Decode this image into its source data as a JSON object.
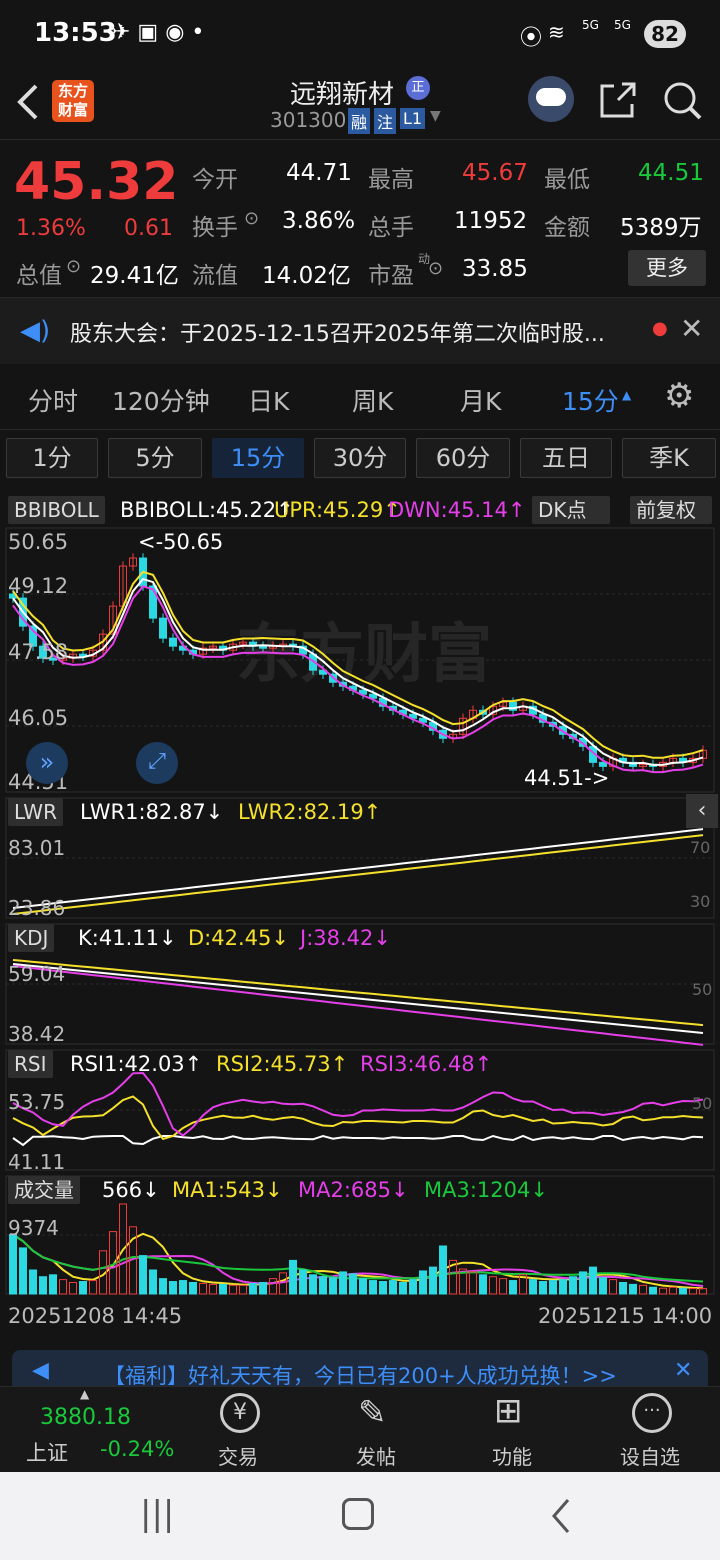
{
  "status": {
    "time": "13:53",
    "battery": "82",
    "net1": "5G",
    "net2": "5G"
  },
  "header": {
    "logo_line1": "东方",
    "logo_line2": "财富",
    "name": "远翔新材",
    "name_badge": "正",
    "code": "301300",
    "tag_rong": "融",
    "tag_zhu": "注",
    "tag_level": "L1"
  },
  "quote": {
    "price": "45.32",
    "change_pct": "1.36%",
    "change": "0.61",
    "open_label": "今开",
    "open": "44.71",
    "high_label": "最高",
    "high": "45.67",
    "low_label": "最低",
    "low": "44.51",
    "turnover_label": "换手",
    "turnover": "3.86%",
    "volume_label": "总手",
    "volume": "11952",
    "amount_label": "金额",
    "amount": "5389万",
    "mcap_label": "总值",
    "mcap": "29.41亿",
    "float_label": "流值",
    "float": "14.02亿",
    "pe_label": "市盈",
    "pe_sup": "动",
    "pe": "33.85",
    "more": "更多"
  },
  "notice": {
    "text": "股东大会：于2025-12-15召开2025年第二次临时股..."
  },
  "tabs": [
    "分时",
    "120分钟",
    "日K",
    "周K",
    "月K",
    "15分"
  ],
  "subtabs": [
    "1分",
    "5分",
    "15分",
    "30分",
    "60分",
    "五日",
    "季K"
  ],
  "active_subtab": 2,
  "boll": {
    "tag": "BBIBOLL",
    "mid": "BBIBOLL:45.22↑",
    "upr": "UPR:45.29↑",
    "dwn": "DWN:45.14↑",
    "dk": "DK点",
    "fq": "前复权",
    "y_labels": [
      "50.65",
      "49.12",
      "47.58",
      "46.05",
      "44.51"
    ],
    "max_label": "<-50.65",
    "min_label": "44.51->",
    "watermark": "东方财富"
  },
  "lwr": {
    "tag": "LWR",
    "v1": "LWR1:82.87↓",
    "v2": "LWR2:82.19↑",
    "top": "83.01",
    "bottom": "23.86",
    "r1": "70",
    "r2": "30"
  },
  "kdj": {
    "tag": "KDJ",
    "k": "K:41.11↓",
    "d": "D:42.45↓",
    "j": "J:38.42↓",
    "top": "59.04",
    "bottom": "38.42",
    "r1": "50"
  },
  "rsi": {
    "tag": "RSI",
    "r1": "RSI1:42.03↑",
    "r2": "RSI2:45.73↑",
    "r3": "RSI3:46.48↑",
    "top": "53.75",
    "bottom": "41.11",
    "r50": "50"
  },
  "vol": {
    "tag": "成交量",
    "v": "566↓",
    "ma1": "MA1:543↓",
    "ma2": "MA2:685↓",
    "ma3": "MA3:1204↓",
    "top": "9374"
  },
  "dates": {
    "start": "20251208 14:45",
    "end": "20251215 14:00"
  },
  "banner": {
    "text": "【福利】好礼天天有，今日已有200+人成功兑换！>>"
  },
  "bottom": {
    "index_value": "3880.18",
    "index_name": "上证",
    "index_change": "-0.24%",
    "trade": "交易",
    "post": "发帖",
    "func": "功能",
    "watch": "设自选"
  },
  "chart_data": {
    "type": "candlestick",
    "series_note": "15-min K line",
    "price_max": 50.65,
    "price_min": 44.51,
    "close": [
      49.1,
      48.4,
      47.9,
      47.6,
      47.55,
      47.6,
      47.7,
      47.65,
      47.8,
      48.2,
      48.9,
      49.9,
      50.1,
      49.4,
      48.6,
      48.1,
      47.9,
      47.8,
      47.7,
      47.85,
      47.9,
      47.8,
      47.95,
      48.0,
      47.9,
      47.85,
      47.9,
      47.95,
      47.9,
      47.7,
      47.3,
      47.2,
      47.0,
      46.9,
      46.8,
      46.7,
      46.6,
      46.4,
      46.3,
      46.2,
      46.1,
      46.0,
      45.8,
      45.6,
      45.7,
      46.1,
      46.3,
      46.2,
      46.4,
      46.5,
      46.3,
      46.4,
      46.2,
      46.0,
      45.9,
      45.7,
      45.6,
      45.4,
      45.0,
      44.9,
      45.1,
      45.0,
      44.9,
      44.95,
      44.9,
      45.0,
      45.1,
      45.0,
      45.1,
      45.3
    ],
    "volume": [
      6200,
      4800,
      2500,
      1800,
      2000,
      1500,
      1200,
      1300,
      1400,
      4500,
      6500,
      9374,
      7000,
      4000,
      2500,
      1600,
      1300,
      1400,
      1200,
      1100,
      1000,
      1000,
      900,
      900,
      1100,
      1200,
      1600,
      2200,
      3500,
      2500,
      2000,
      1800,
      1700,
      2300,
      2100,
      1600,
      1400,
      1300,
      1400,
      1200,
      1500,
      2400,
      2800,
      5000,
      3500,
      2600,
      2300,
      2000,
      1800,
      1600,
      1400,
      2000,
      1500,
      1300,
      1400,
      1500,
      1800,
      2300,
      2800,
      1700,
      1500,
      1200,
      1000,
      900,
      700,
      600,
      700,
      600,
      566,
      566
    ]
  }
}
